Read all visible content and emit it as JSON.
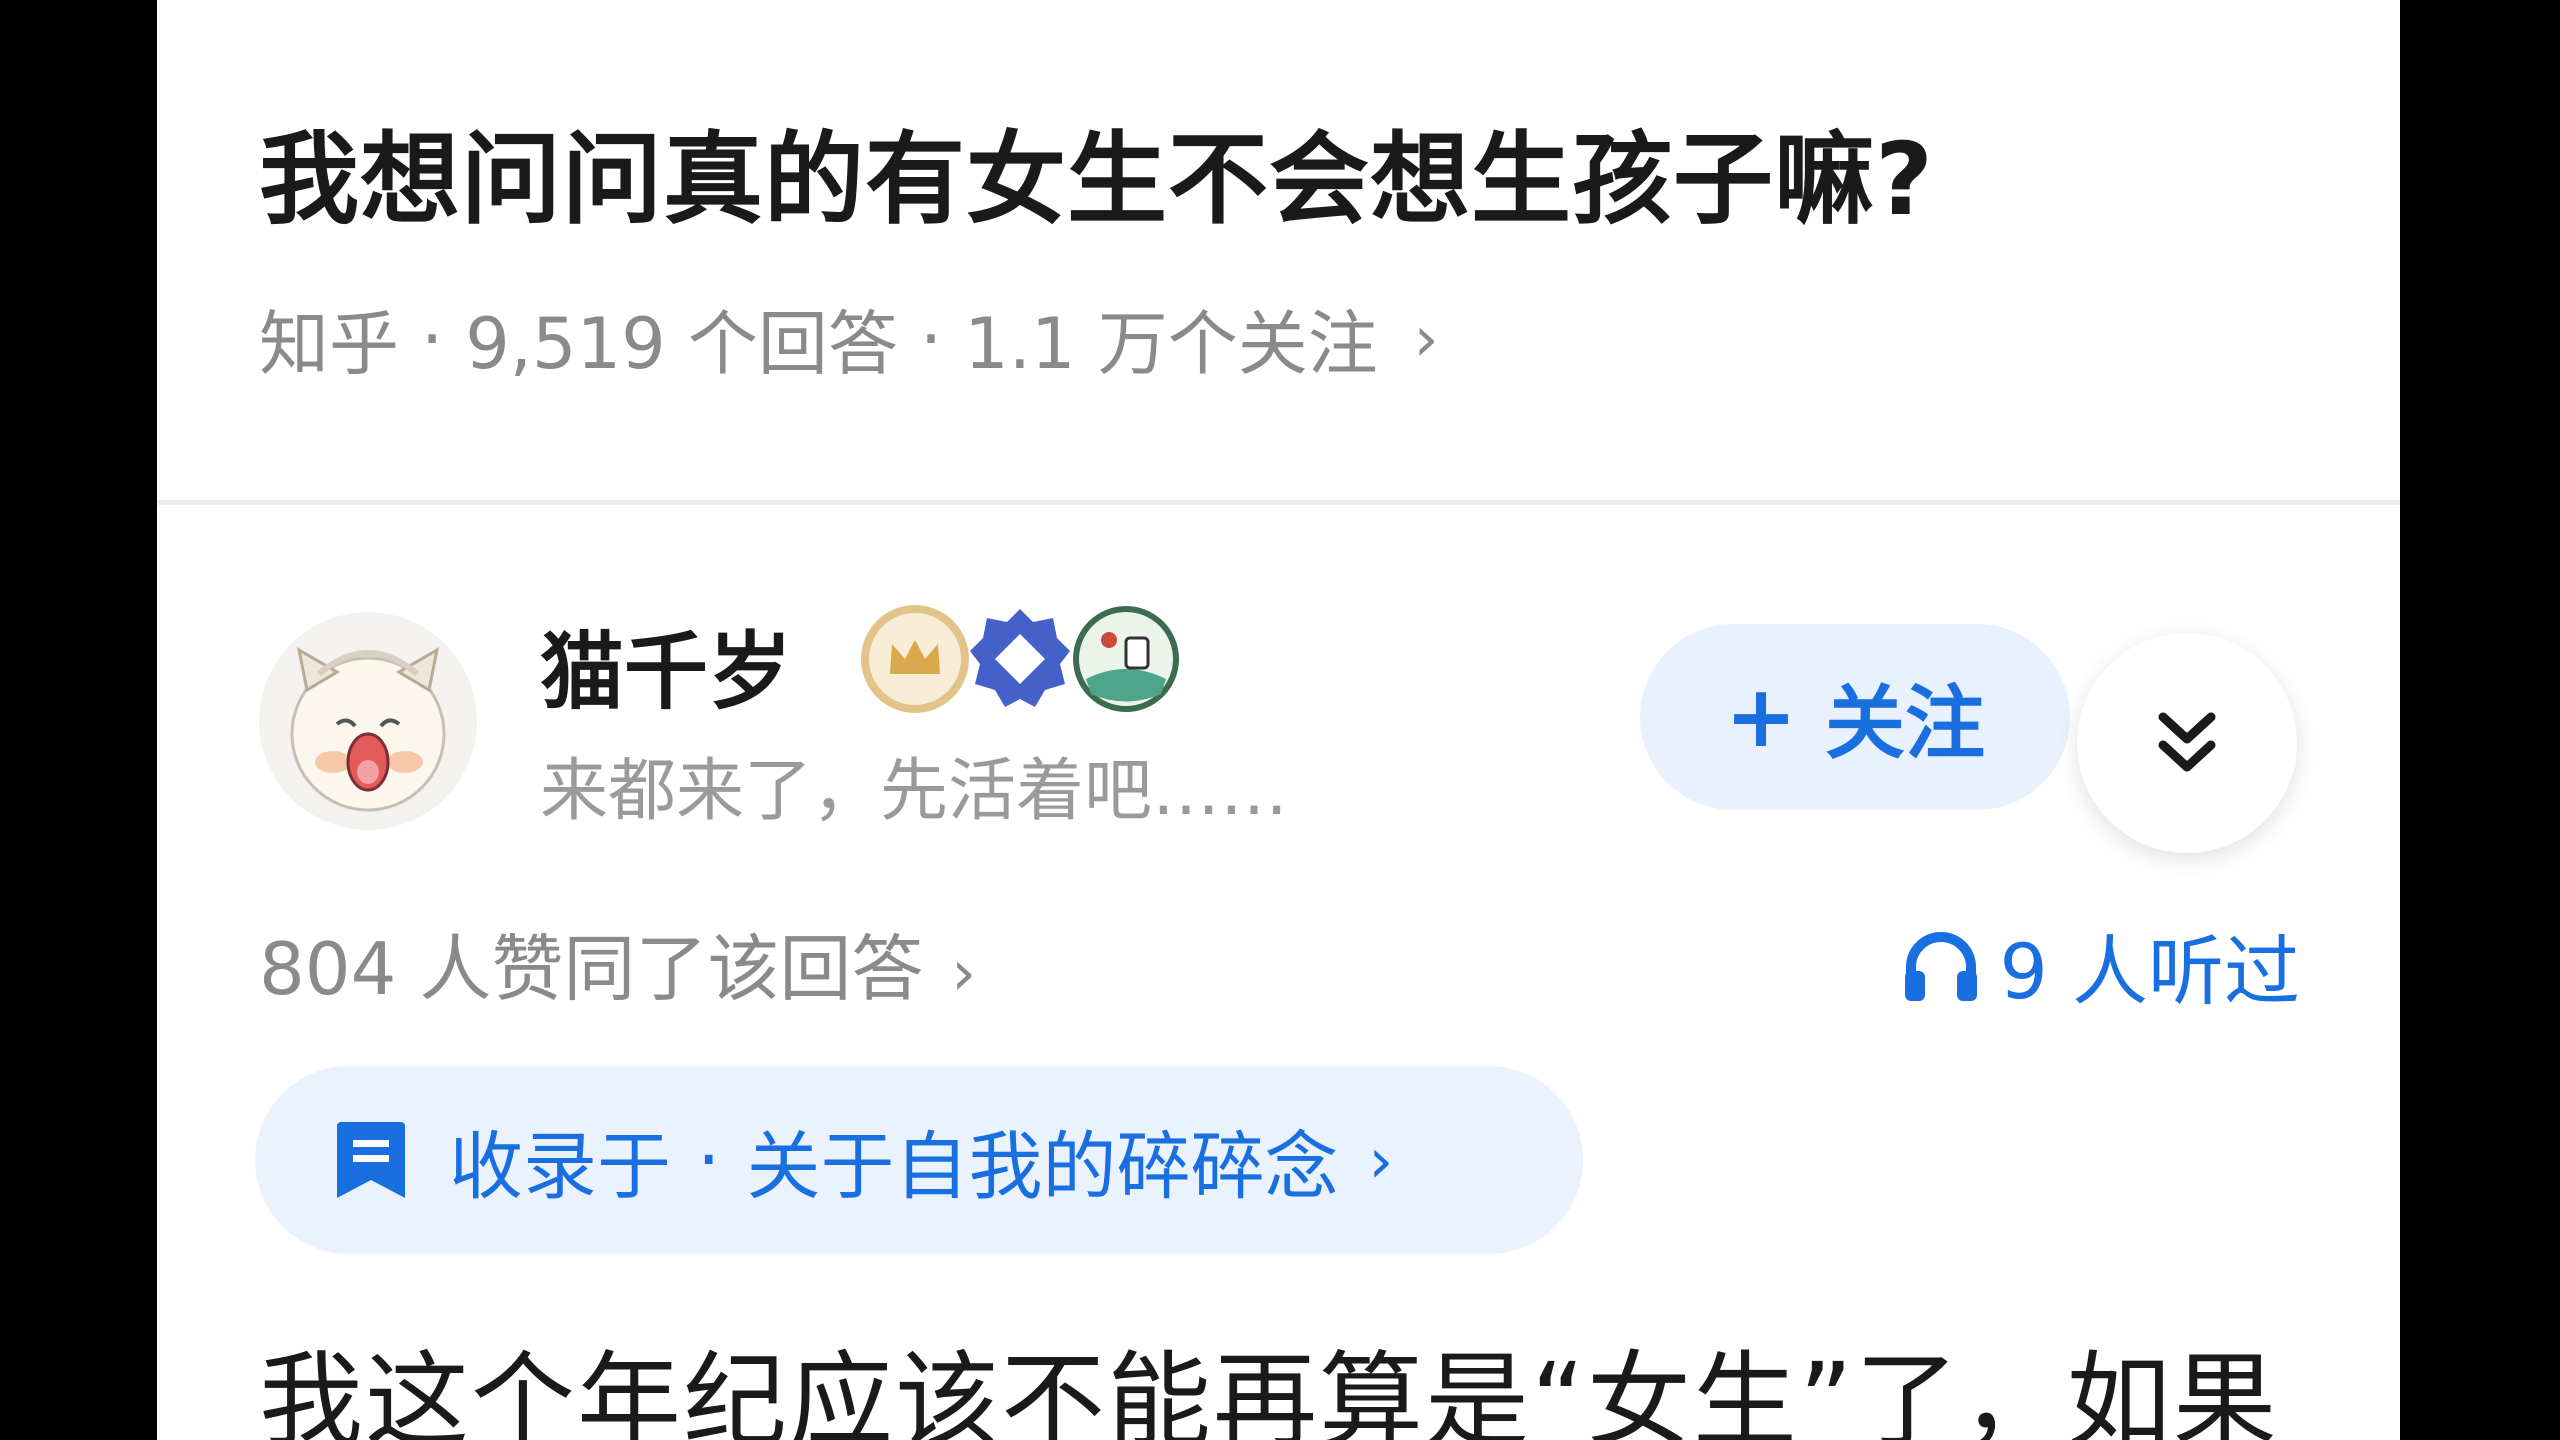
{
  "question": {
    "title": "我想问问真的有女生不会想生孩子嘛?",
    "source": "知乎",
    "answers": "9,519 个回答",
    "followers": "1.1 万个关注",
    "chevron": "›"
  },
  "author": {
    "name": "猫千岁",
    "bio": "来都来了，先活着吧……",
    "badges": [
      "crown-badge-icon",
      "diamond-badge-icon",
      "illustration-badge-icon"
    ],
    "follow_plus": "+",
    "follow_label": "关注"
  },
  "stats": {
    "upvotes": "804 人赞同了该回答",
    "chevron": "›",
    "listened": "9 人听过"
  },
  "collection": {
    "label": "收录于",
    "dot": "·",
    "name": "关于自我的碎碎念",
    "chevron": "›"
  },
  "answer_preview": "我这个年纪应该不能再算是“女生”了，如果",
  "colors": {
    "accent": "#1a6fe0",
    "accent_bg": "#e8f1fd",
    "text": "#1a1a1a",
    "muted": "#8a8a8a"
  }
}
